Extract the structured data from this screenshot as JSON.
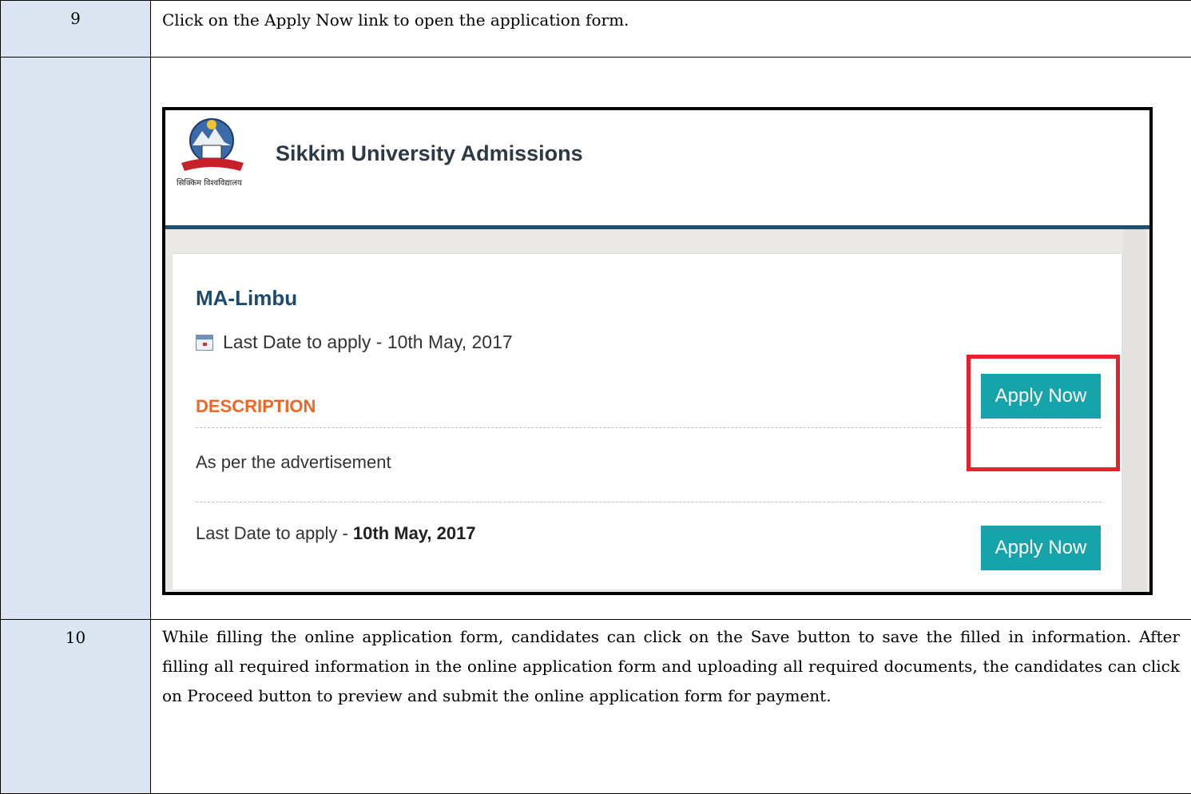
{
  "steps": [
    {
      "number": "9",
      "text": "Click on the Apply Now link to open the application form."
    },
    {
      "number": "",
      "text": ""
    },
    {
      "number": "10",
      "text": "While filling the online application form, candidates can click on the Save button to save the filled in information. After filling all required information in the online application form and uploading all required documents, the candidates can click on Proceed button to preview and submit the online application form for payment."
    }
  ],
  "screenshot": {
    "site_title": "Sikkim University Admissions",
    "logo_text": "सिक्किम विश्वविद्यालय",
    "course_title": "MA-Limbu",
    "last_date_line": "Last Date to apply - 10th May, 2017",
    "description_heading": "DESCRIPTION",
    "description_text": "As per the advertisement",
    "bottom_date_label": "Last Date to apply - ",
    "bottom_date_value": "10th May, 2017",
    "apply_button_label": "Apply Now",
    "highlight_color": "#e8202a",
    "accent_color": "#17a3aa",
    "header_bar_color": "#1f4e6e",
    "description_color": "#f26522"
  }
}
